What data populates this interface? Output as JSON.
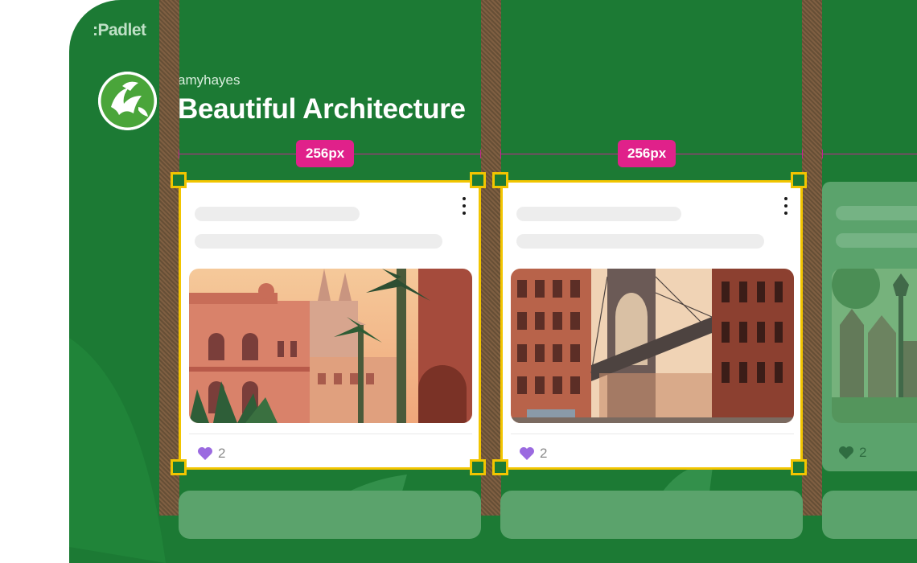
{
  "brand": {
    "logo_text": ":Padlet"
  },
  "board": {
    "owner": "amyhayes",
    "title": "Beautiful Architecture"
  },
  "guides": {
    "column_width_label_1": "256px",
    "column_width_label_2": "256px"
  },
  "posts": [
    {
      "image_subject": "mediterranean-city-illustration",
      "likes": "2",
      "like_icon": "heart-icon",
      "selected": true
    },
    {
      "image_subject": "brooklyn-bridge-street-illustration",
      "likes": "2",
      "like_icon": "heart-icon",
      "selected": true
    },
    {
      "image_subject": "european-street-lamp-illustration",
      "likes": "2",
      "like_icon": "heart-icon",
      "selected": false
    }
  ],
  "colors": {
    "board_background": "#1c7a34",
    "selection": "#f2c500",
    "measure_badge": "#e0218a",
    "like_heart": "#9b6ae0"
  }
}
